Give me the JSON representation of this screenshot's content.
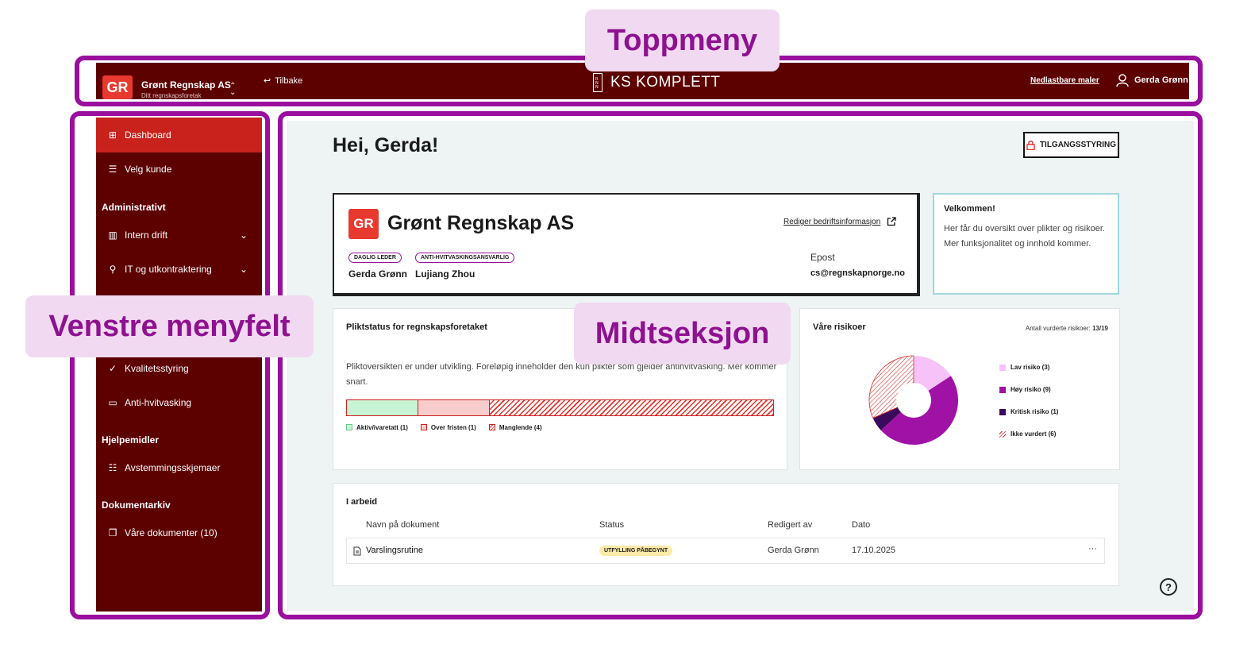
{
  "annotations": {
    "top_menu": "Toppmeny",
    "left_menu": "Venstre menyfelt",
    "middle": "Midtseksjon"
  },
  "topbar": {
    "badge": "GR",
    "org_name": "Grønt Regnskap AS",
    "org_sub": "Ditt regnskapsforetak",
    "back_label": "Tilbake",
    "logo_text": "KS KOMPLETT",
    "templates_link": "Nedlastbare maler",
    "user_name": "Gerda Grønn"
  },
  "sidebar": {
    "dashboard": "Dashboard",
    "choose_client": "Velg kunde",
    "section_admin": "Administrativt",
    "internal": "Intern drift",
    "it": "IT og utkontraktering",
    "quality": "Kvalitetsstyring",
    "aml": "Anti-hvitvasking",
    "section_tools": "Hjelpemidler",
    "reconciliation": "Avstemmingsskjemaer",
    "section_archive": "Dokumentarkiv",
    "documents": "Våre dokumenter (10)"
  },
  "main": {
    "greeting": "Hei, Gerda!",
    "access_button": "TILGANGSSTYRING",
    "company": {
      "badge": "GR",
      "name": "Grønt Regnskap AS",
      "edit_link": "Rediger bedriftsinformasjon",
      "role1": "DAGLIG LEDER",
      "person1": "Gerda Grønn",
      "role2": "ANTI-HVITVASKINGSANSVARLIG",
      "person2": "Lujiang Zhou",
      "email_label": "Epost",
      "email": "cs@regnskapnorge.no"
    },
    "welcome": {
      "title": "Velkommen!",
      "body": "Her får du oversikt over plikter og risikoer. Mer funksjonalitet og innhold kommer."
    },
    "duties": {
      "title": "Pliktstatus for regnskapsforetaket",
      "description": "Pliktoversikten er under utvikling. Foreløpig inneholder den kun plikter som gjelder antihvitvasking. Mer kommer snart.",
      "legend_active": "Aktiv/ivaretatt (1)",
      "legend_overdue": "Over fristen (1)",
      "legend_missing": "Manglende (4)",
      "counts": {
        "active": 1,
        "overdue": 1,
        "missing": 4
      }
    },
    "risks": {
      "title": "Våre risikoer",
      "count_label": "Antall vurderte risikoer:",
      "count_value": "13/19",
      "legend_low": "Lav risiko (3)",
      "legend_high": "Høy risiko (9)",
      "legend_critical": "Kritisk risiko (1)",
      "legend_unassessed": "Ikke vurdert (6)",
      "colors": {
        "low": "#f7c2f7",
        "high": "#a012a6",
        "critical": "#3b0a5c",
        "unassessed": "#e0302a"
      }
    },
    "work": {
      "title": "I arbeid",
      "col_name": "Navn på dokument",
      "col_status": "Status",
      "col_editor": "Redigert av",
      "col_date": "Dato",
      "row": {
        "name": "Varslingsrutine",
        "status": "UTFYLLING PÅBEGYNT",
        "editor": "Gerda Grønn",
        "date": "17.10.2025",
        "menu": "···"
      }
    },
    "help": "?"
  },
  "chart_data": {
    "type": "pie",
    "categories": [
      "Lav risiko",
      "Høy risiko",
      "Kritisk risiko",
      "Ikke vurdert"
    ],
    "values": [
      3,
      9,
      1,
      6
    ],
    "title": "Våre risikoer"
  }
}
